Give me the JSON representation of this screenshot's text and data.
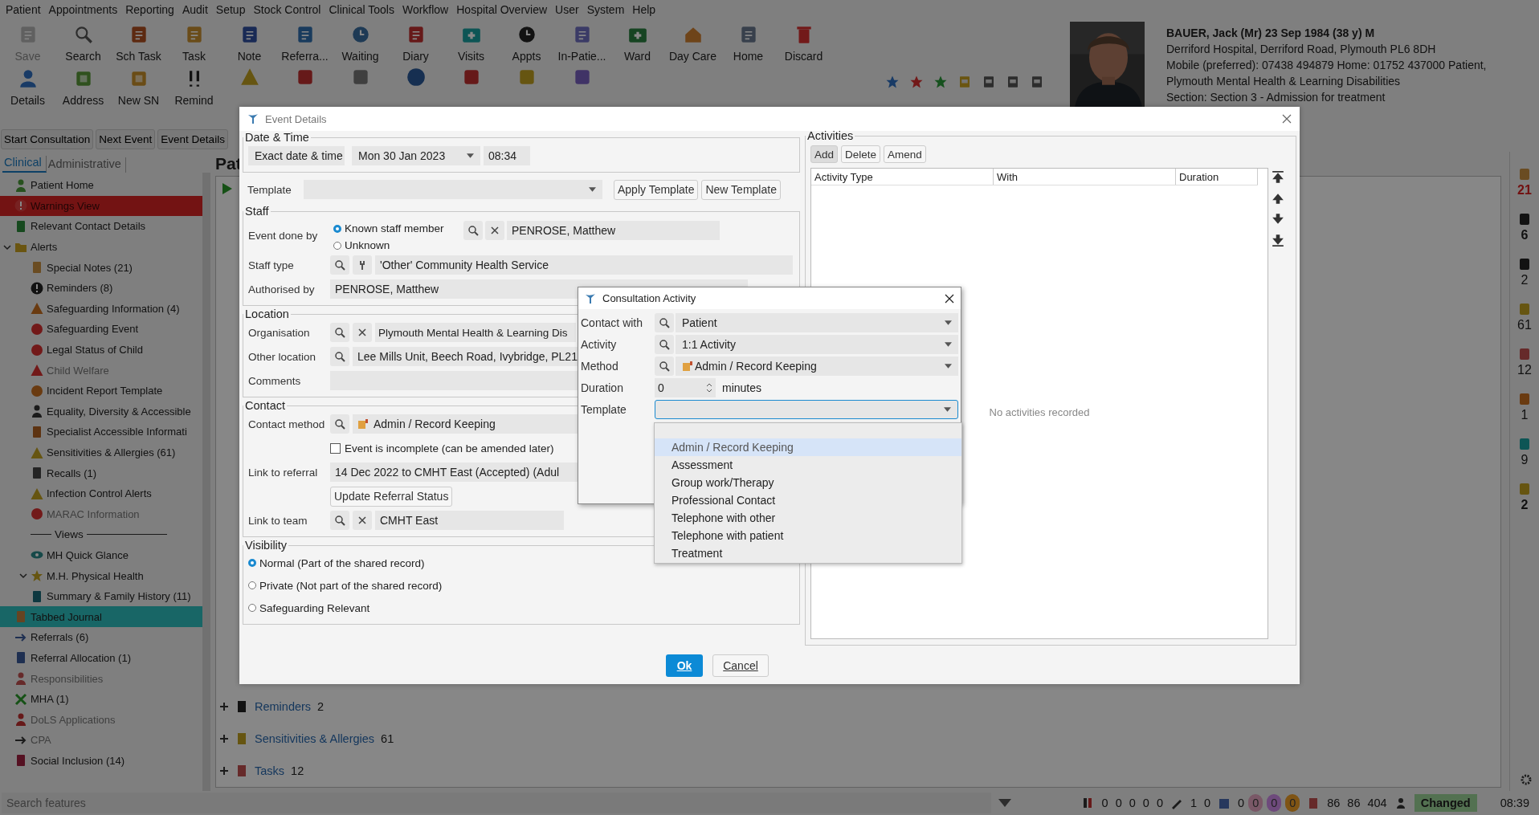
{
  "menu": [
    "Patient",
    "Appointments",
    "Reporting",
    "Audit",
    "Setup",
    "Stock Control",
    "Clinical Tools",
    "Workflow",
    "Hospital Overview",
    "User",
    "System",
    "Help"
  ],
  "toolbar": [
    {
      "label": "Save",
      "disabled": true
    },
    {
      "label": "Search",
      "disabled": false
    },
    {
      "label": "Sch Task",
      "disabled": false
    },
    {
      "label": "Task",
      "disabled": false
    },
    {
      "label": "Note",
      "disabled": false
    },
    {
      "label": "Referra...",
      "disabled": false
    },
    {
      "label": "Waiting",
      "disabled": false
    },
    {
      "label": "Diary",
      "disabled": false
    },
    {
      "label": "Visits",
      "disabled": false
    },
    {
      "label": "Appts",
      "disabled": false
    },
    {
      "label": "In-Patie...",
      "disabled": false
    },
    {
      "label": "Ward",
      "disabled": false
    },
    {
      "label": "Day Care",
      "disabled": false
    },
    {
      "label": "Home",
      "disabled": false
    },
    {
      "label": "Discard",
      "disabled": false
    }
  ],
  "toolbar_row2": [
    {
      "label": "Details"
    },
    {
      "label": "Address"
    },
    {
      "label": "New SN"
    },
    {
      "label": "Remind"
    }
  ],
  "patient": {
    "name": "BAUER, Jack (Mr) 23 Sep 1984 (38 y) M",
    "address": "Derriford Hospital, Derriford Road, Plymouth PL6 8DH",
    "phones": "Mobile (preferred): 07438 494879 Home: 01752 437000   Patient,",
    "organisation": "Plymouth Mental Health & Learning Disabilities",
    "section": "Section: Section 3 - Admission for treatment"
  },
  "actions": [
    "Start Consultation",
    "Next Event",
    "Event Details"
  ],
  "sidebar_tabs": [
    {
      "label": "Clinical",
      "selected": true
    },
    {
      "label": "Administrative",
      "selected": false
    }
  ],
  "sidebar": [
    {
      "label": "Patient Home",
      "selected": false,
      "greyed": false,
      "warning": false
    },
    {
      "label": "Warnings View",
      "selected": false,
      "greyed": false,
      "warning": true
    },
    {
      "label": "Relevant Contact Details",
      "selected": false,
      "greyed": false,
      "warning": false
    },
    {
      "label": "Alerts",
      "selected": false,
      "greyed": false,
      "warning": false,
      "expanded": true,
      "children": [
        {
          "label": "Special Notes (21)",
          "selected": false,
          "greyed": false,
          "warning": false
        },
        {
          "label": "Reminders (8)",
          "selected": false,
          "greyed": false,
          "warning": false
        },
        {
          "label": "Safeguarding Information (4)",
          "selected": false,
          "greyed": false,
          "warning": false
        },
        {
          "label": "Safeguarding Event",
          "selected": false,
          "greyed": false,
          "warning": false
        },
        {
          "label": "Legal Status of Child",
          "selected": false,
          "greyed": false,
          "warning": false
        },
        {
          "label": "Child Welfare",
          "selected": false,
          "greyed": true,
          "warning": false
        },
        {
          "label": "Incident Report Template",
          "selected": false,
          "greyed": false,
          "warning": false
        },
        {
          "label": "Equality, Diversity & Accessible",
          "selected": false,
          "greyed": false,
          "warning": false
        },
        {
          "label": "Specialist Accessible Informati",
          "selected": false,
          "greyed": false,
          "warning": false
        },
        {
          "label": "Sensitivities & Allergies (61)",
          "selected": false,
          "greyed": false,
          "warning": false
        },
        {
          "label": "Recalls (1)",
          "selected": false,
          "greyed": false,
          "warning": false
        },
        {
          "label": "Infection Control Alerts",
          "selected": false,
          "greyed": false,
          "warning": false
        },
        {
          "label": "MARAC Information",
          "selected": false,
          "greyed": true,
          "warning": false
        },
        {
          "label": "Views",
          "kind": "separator"
        },
        {
          "label": "MH Quick Glance",
          "selected": false,
          "greyed": false,
          "warning": false
        },
        {
          "label": "M.H. Physical Health",
          "selected": false,
          "greyed": false,
          "warning": false,
          "expanded": true,
          "children": [
            {
              "label": "Summary & Family History (11)",
              "selected": false,
              "greyed": false,
              "warning": false
            }
          ]
        }
      ]
    },
    {
      "label": "Tabbed Journal",
      "selected": true,
      "greyed": false,
      "warning": false
    },
    {
      "label": "Referrals (6)",
      "selected": false,
      "greyed": false,
      "warning": false
    },
    {
      "label": "Referral Allocation (1)",
      "selected": false,
      "greyed": false,
      "warning": false
    },
    {
      "label": "Responsibilities",
      "selected": false,
      "greyed": true,
      "warning": false
    },
    {
      "label": "MHA (1)",
      "selected": false,
      "greyed": false,
      "warning": false
    },
    {
      "label": "DoLS Applications",
      "selected": false,
      "greyed": true,
      "warning": false
    },
    {
      "label": "CPA",
      "selected": false,
      "greyed": true,
      "warning": false
    },
    {
      "label": "Social Inclusion (14)",
      "selected": false,
      "greyed": false,
      "warning": false
    }
  ],
  "main": {
    "heading": "Pat",
    "sections": [
      {
        "label": "Reminders",
        "count": "2",
        "expanded": false
      },
      {
        "label": "Sensitivities & Allergies",
        "count": "61",
        "expanded": false
      },
      {
        "label": "Tasks",
        "count": "12",
        "expanded": false
      }
    ]
  },
  "right_strip": [
    {
      "value": "21",
      "bold": true,
      "alert": true
    },
    {
      "value": "6",
      "bold": true,
      "alert": false
    },
    {
      "value": "2",
      "bold": false,
      "alert": false
    },
    {
      "value": "61",
      "bold": false,
      "alert": false
    },
    {
      "value": "12",
      "bold": false,
      "alert": false
    },
    {
      "value": "1",
      "bold": false,
      "alert": false
    },
    {
      "value": "9",
      "bold": false,
      "alert": false
    },
    {
      "value": "2",
      "bold": true,
      "alert": false
    }
  ],
  "status": {
    "search_placeholder": "Search features",
    "counts_a": [
      "0",
      "0",
      "0",
      "0",
      "0"
    ],
    "counts_b": [
      "1",
      "0"
    ],
    "count_c": "0",
    "badges": [
      {
        "value": "0",
        "color": "#7a5867"
      },
      {
        "value": "0",
        "color": "#6e4a7c"
      },
      {
        "value": "0",
        "color": "#7f5414"
      }
    ],
    "counts_d": [
      "86",
      "86",
      "404"
    ],
    "state": "Changed",
    "time": "08:39"
  },
  "event_dialog": {
    "title": "Event Details",
    "date_time": {
      "legend": "Date & Time",
      "mode": "Exact date & time",
      "date": "Mon 30 Jan 2023",
      "time": "08:34"
    },
    "template": {
      "label": "Template",
      "buttons": [
        "Apply Template",
        "New Template"
      ]
    },
    "staff": {
      "legend": "Staff",
      "done_by_label": "Event done by",
      "options": [
        {
          "label": "Known staff member",
          "selected": true
        },
        {
          "label": "Unknown",
          "selected": false
        }
      ],
      "member": "PENROSE, Matthew",
      "type_label": "Staff type",
      "type": "'Other' Community Health Service",
      "authorised_label": "Authorised by",
      "authorised": "PENROSE, Matthew"
    },
    "location": {
      "legend": "Location",
      "org_label": "Organisation",
      "org": "Plymouth Mental Health & Learning Dis",
      "other_label": "Other location",
      "other": "Lee Mills Unit, Beech Road, Ivybridge, PL21",
      "comments_label": "Comments"
    },
    "contact": {
      "legend": "Contact",
      "method_label": "Contact method",
      "method": "Admin / Record Keeping",
      "incomplete": {
        "label": "Event is incomplete (can be amended later)",
        "checked": false
      },
      "referral_label": "Link to referral",
      "referral": "14 Dec 2022 to CMHT East (Accepted)  (Adul",
      "referral_button": "Update Referral Status",
      "team_label": "Link to team",
      "team": "CMHT East"
    },
    "visibility": {
      "legend": "Visibility",
      "options": [
        {
          "label": "Normal (Part of the shared record)",
          "selected": true
        },
        {
          "label": "Private (Not part of the shared record)",
          "selected": false
        },
        {
          "label": "Safeguarding Relevant",
          "selected": false
        }
      ]
    },
    "activities": {
      "legend": "Activities",
      "buttons": [
        "Add",
        "Delete",
        "Amend"
      ],
      "columns": [
        "Activity Type",
        "With",
        "Duration"
      ],
      "empty": "No activities recorded"
    },
    "ok": "Ok",
    "cancel": "Cancel"
  },
  "activity_dialog": {
    "title": "Consultation Activity",
    "contact_label": "Contact with",
    "contact": "Patient",
    "activity_label": "Activity",
    "activity": "1:1 Activity",
    "method_label": "Method",
    "method": "Admin / Record Keeping",
    "duration_label": "Duration",
    "duration": "0",
    "duration_unit": "minutes",
    "template_label": "Template",
    "options": [
      {
        "label": "Admin / Record Keeping",
        "selected": true
      },
      {
        "label": "Assessment",
        "selected": false
      },
      {
        "label": "Group work/Therapy",
        "selected": false
      },
      {
        "label": "Professional Contact",
        "selected": false
      },
      {
        "label": "Telephone with other",
        "selected": false
      },
      {
        "label": "Telephone with patient",
        "selected": false
      },
      {
        "label": "Treatment",
        "selected": false
      }
    ]
  }
}
